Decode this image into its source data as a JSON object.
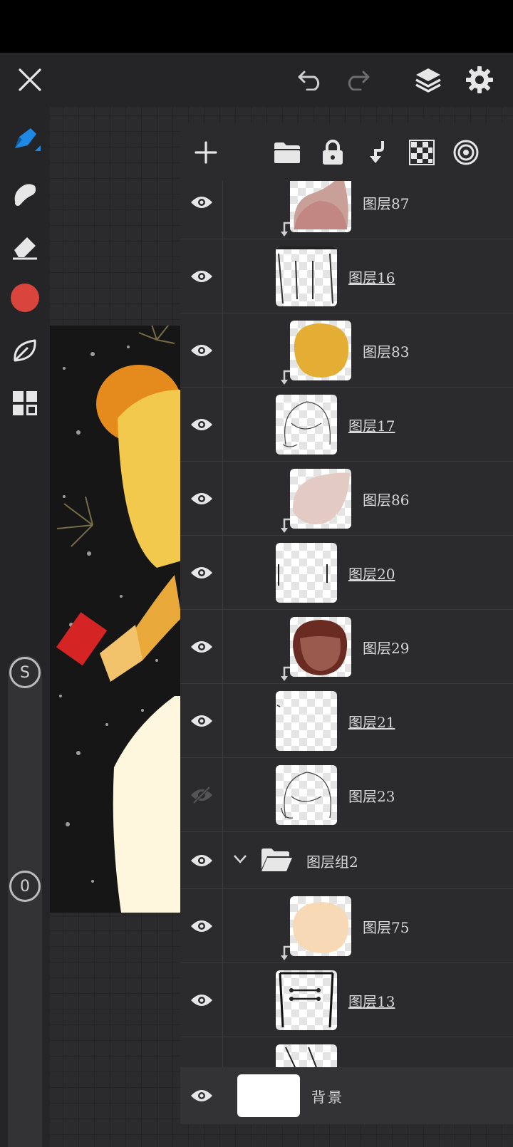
{
  "topbar": {
    "close_icon": "close-icon",
    "undo_icon": "undo-icon",
    "redo_icon": "redo-icon",
    "layers_icon": "layers-icon",
    "settings_icon": "gear-icon"
  },
  "left_toolbar": {
    "tools": [
      "brush-icon",
      "smudge-icon",
      "eraser-icon",
      "color-swatch",
      "leaf-icon",
      "grid-icon"
    ],
    "current_color": "#d9453c",
    "accent_color": "#1e88e5",
    "size_slider_label": "S",
    "opacity_slider_label": "0"
  },
  "layers_panel": {
    "toolbar_icons": [
      "plus-icon",
      "folder-icon",
      "lock-icon",
      "merge-down-icon",
      "transparency-icon",
      "blend-icon"
    ],
    "layers": [
      {
        "name": "图层87",
        "clipped": true,
        "visible": true
      },
      {
        "name": "图层16",
        "clipped": false,
        "visible": true
      },
      {
        "name": "图层83",
        "clipped": true,
        "visible": true
      },
      {
        "name": "图层17",
        "clipped": false,
        "visible": true
      },
      {
        "name": "图层86",
        "clipped": true,
        "visible": true
      },
      {
        "name": "图层20",
        "clipped": false,
        "visible": true
      },
      {
        "name": "图层29",
        "clipped": true,
        "visible": true
      },
      {
        "name": "图层21",
        "clipped": false,
        "visible": true
      },
      {
        "name": "图层23",
        "clipped": false,
        "visible": false
      }
    ],
    "group": {
      "name": "图层组2",
      "expanded": true,
      "visible": true
    },
    "group_layers": [
      {
        "name": "图层75",
        "clipped": true,
        "visible": true
      },
      {
        "name": "图层13",
        "clipped": false,
        "visible": true
      }
    ],
    "background": {
      "name": "背景",
      "visible": true
    }
  }
}
